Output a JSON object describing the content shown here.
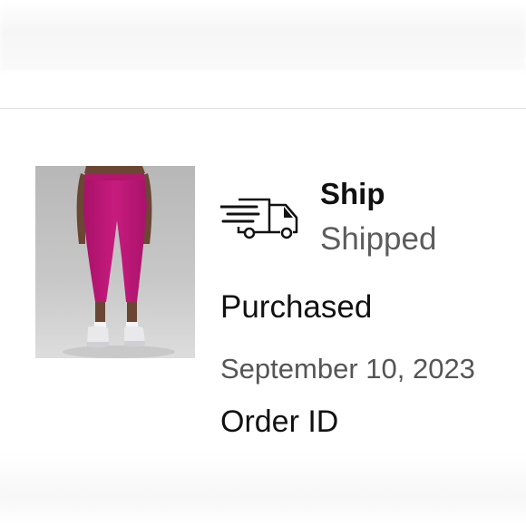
{
  "order": {
    "product_image_alt": "",
    "shipping": {
      "icon": "delivery-truck-icon",
      "title": "Ship",
      "status": "Shipped"
    },
    "purchased": {
      "label": "Purchased",
      "date": "September 10, 2023"
    },
    "order_id": {
      "label": "Order ID"
    }
  },
  "colors": {
    "primary_text": "#111111",
    "secondary_text": "#5c5c5c",
    "legging_color": "#c2187a",
    "divider": "#e2e2e2"
  }
}
